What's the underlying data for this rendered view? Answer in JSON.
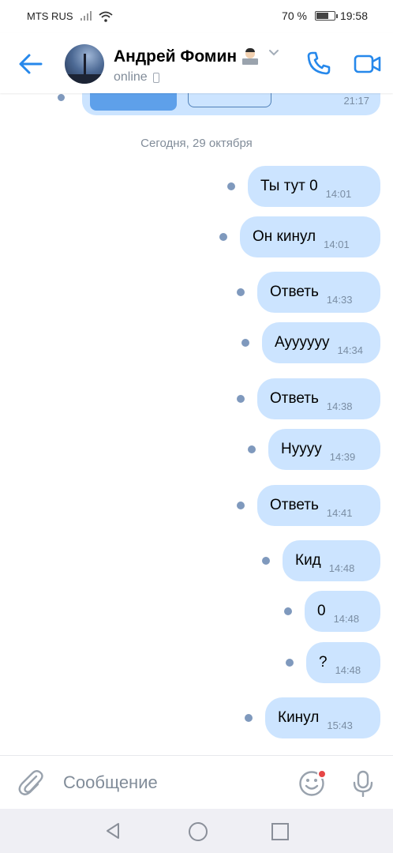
{
  "status_bar": {
    "carrier": "MTS RUS",
    "battery": "70 %",
    "battery_level": 0.7,
    "time": "19:58"
  },
  "header": {
    "contact_name": "Андрей Фомин",
    "status": "online",
    "icons": [
      "back-arrow-icon",
      "call-icon",
      "video-call-icon",
      "chevron-down-icon"
    ]
  },
  "chat": {
    "previous_message_time": "21:17",
    "date_separator": "Сегодня, 29 октября",
    "messages": [
      {
        "text": "Ты тут 0",
        "time": "14:01"
      },
      {
        "text": "Он кинул",
        "time": "14:01"
      },
      {
        "text": "Ответь",
        "time": "14:33"
      },
      {
        "text": "Ауууууу",
        "time": "14:34"
      },
      {
        "text": "Ответь",
        "time": "14:38"
      },
      {
        "text": "Нуууу",
        "time": "14:39"
      },
      {
        "text": "Ответь",
        "time": "14:41"
      },
      {
        "text": "Кид",
        "time": "14:48"
      },
      {
        "text": "0",
        "time": "14:48"
      },
      {
        "text": "?",
        "time": "14:48"
      },
      {
        "text": "Кинул",
        "time": "15:43"
      }
    ]
  },
  "input": {
    "placeholder": "Сообщение"
  },
  "colors": {
    "accent": "#2688eb",
    "bubble": "#cce4ff",
    "unread_dot": "#7f99bd",
    "secondary_text": "#818c99"
  }
}
